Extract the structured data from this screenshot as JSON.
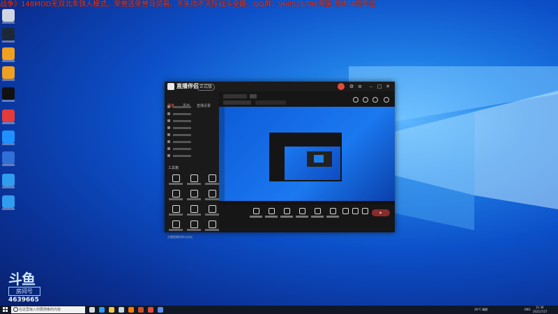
{
  "ticker": {
    "text": "战争》148MOD无双北条铁人模式。荣誉选荣誉马贸易。不失败不灭队战斗全趣。QQ群：960526786荣圃 月中 4周年记"
  },
  "desktop_icons": [
    {
      "name": "recycle-bin",
      "color": "#cfd6e2"
    },
    {
      "name": "steam",
      "color": "#1b2838"
    },
    {
      "name": "help",
      "color": "#f0a020"
    },
    {
      "name": "help-2",
      "color": "#f0a020"
    },
    {
      "name": "qq",
      "color": "#111111"
    },
    {
      "name": "tool",
      "color": "#e33b3b"
    },
    {
      "name": "tool-2",
      "color": "#1e90ff"
    },
    {
      "name": "network",
      "color": "#2f6fd6"
    },
    {
      "name": "app",
      "color": "#2f9cf0"
    },
    {
      "name": "app-2",
      "color": "#2f9cf0"
    }
  ],
  "watermark": {
    "logo": "斗鱼",
    "tag": "房间号",
    "room_id": "4639665"
  },
  "app": {
    "name": "直播伴侣",
    "version": "正式版",
    "tabs": [
      "场景",
      "素材",
      "直播设置"
    ],
    "tools_label": "工具箱",
    "footer": "主播直播须知与协议"
  },
  "taskbar": {
    "search_placeholder": "在这里输入你要搜索的内容",
    "time": "11:36",
    "date": "2021/7/27",
    "weather": "26°C 晴朗",
    "lang": "ENG",
    "apps": [
      {
        "name": "task-view",
        "color": "#d8d8d8"
      },
      {
        "name": "edge",
        "color": "#2a9df4"
      },
      {
        "name": "folder",
        "color": "#f4c542"
      },
      {
        "name": "steam",
        "color": "#c7d5e0"
      },
      {
        "name": "douyu",
        "color": "#ff7a00"
      },
      {
        "name": "game",
        "color": "#c94f2a"
      },
      {
        "name": "app",
        "color": "#e24b3b"
      },
      {
        "name": "app-2",
        "color": "#5b8def"
      }
    ]
  }
}
